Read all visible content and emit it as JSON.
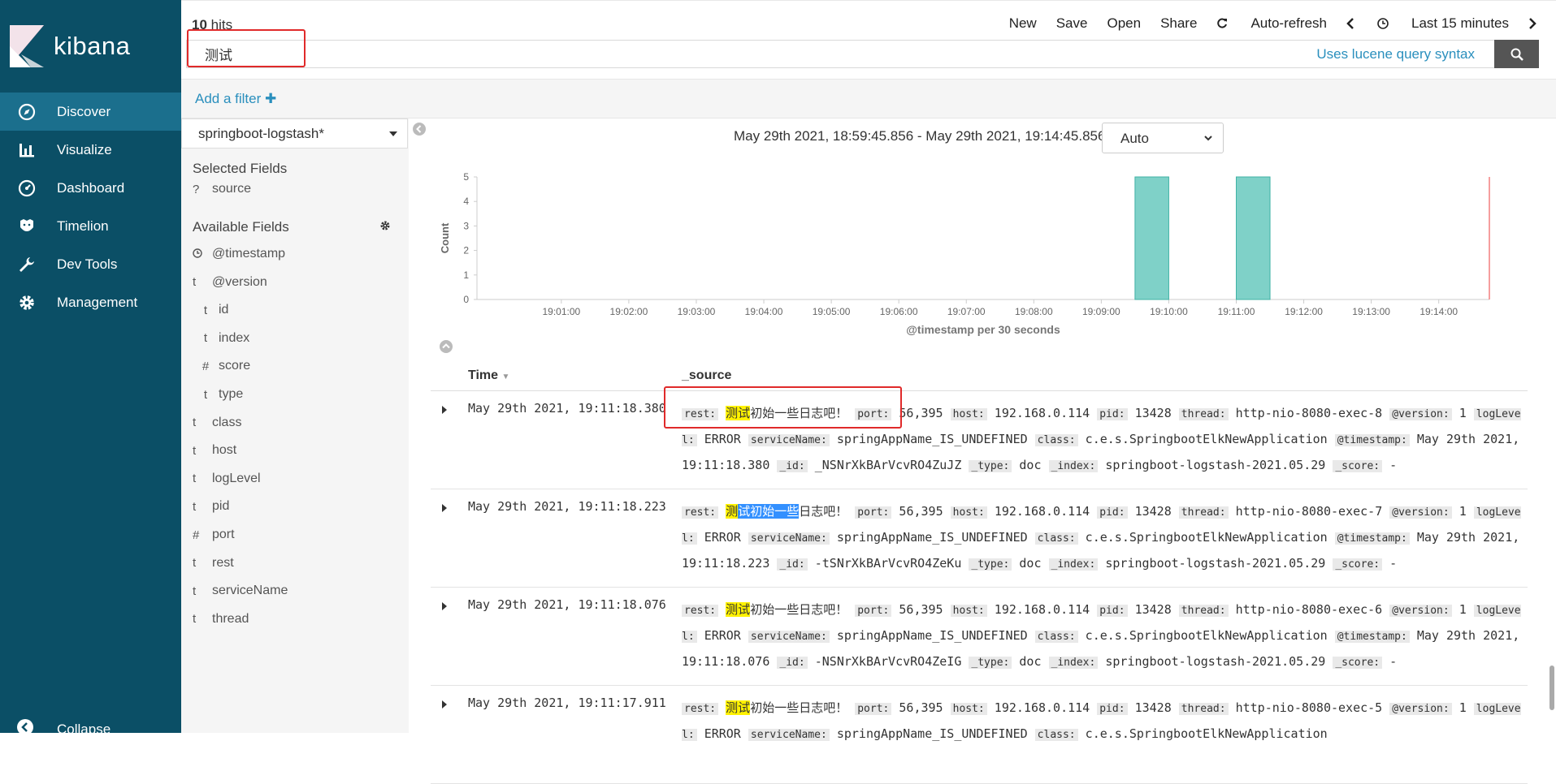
{
  "app": {
    "name": "kibana"
  },
  "nav": {
    "items": [
      {
        "label": "Discover",
        "icon": "compass-icon",
        "active": true
      },
      {
        "label": "Visualize",
        "icon": "bar-chart-icon",
        "active": false
      },
      {
        "label": "Dashboard",
        "icon": "dashboard-icon",
        "active": false
      },
      {
        "label": "Timelion",
        "icon": "timelion-icon",
        "active": false
      },
      {
        "label": "Dev Tools",
        "icon": "wrench-icon",
        "active": false
      },
      {
        "label": "Management",
        "icon": "gear-icon",
        "active": false
      }
    ],
    "collapse_label": "Collapse"
  },
  "header": {
    "hits_count": "10",
    "hits_label": " hits",
    "menu": {
      "new": "New",
      "save": "Save",
      "open": "Open",
      "share": "Share",
      "auto_refresh": "Auto-refresh",
      "time_label": "Last 15 minutes"
    }
  },
  "query": {
    "value": "测试",
    "syntax_link": "Uses lucene query syntax"
  },
  "filters": {
    "add_label": "Add a filter"
  },
  "sidebar": {
    "index_pattern": "springboot-logstash*",
    "selected_title": "Selected Fields",
    "selected_fields": [
      {
        "type": "?",
        "name": "source"
      }
    ],
    "available_title": "Available Fields",
    "available_fields": [
      {
        "type": "clock",
        "name": "@timestamp"
      },
      {
        "type": "t",
        "name": "@version"
      },
      {
        "type": "t",
        "name": "id"
      },
      {
        "type": "t",
        "name": "index"
      },
      {
        "type": "#",
        "name": "score"
      },
      {
        "type": "t",
        "name": "type"
      },
      {
        "type": "t",
        "name": "class"
      },
      {
        "type": "t",
        "name": "host"
      },
      {
        "type": "t",
        "name": "logLevel"
      },
      {
        "type": "t",
        "name": "pid"
      },
      {
        "type": "#",
        "name": "port"
      },
      {
        "type": "t",
        "name": "rest"
      },
      {
        "type": "t",
        "name": "serviceName"
      },
      {
        "type": "t",
        "name": "thread"
      }
    ]
  },
  "histogram": {
    "range_text": "May 29th 2021, 18:59:45.856 - May 29th 2021, 19:14:45.856 —",
    "interval": "Auto"
  },
  "chart_data": {
    "type": "bar",
    "xlabel": "@timestamp per 30 seconds",
    "ylabel": "Count",
    "ylim": [
      0,
      5
    ],
    "yticks": [
      0,
      1,
      2,
      3,
      4,
      5
    ],
    "xticks": [
      "19:01:00",
      "19:02:00",
      "19:03:00",
      "19:04:00",
      "19:05:00",
      "19:06:00",
      "19:07:00",
      "19:08:00",
      "19:09:00",
      "19:10:00",
      "19:11:00",
      "19:12:00",
      "19:13:00",
      "19:14:00"
    ],
    "x_start": "18:59:45",
    "x_end": "19:14:45",
    "bars": [
      {
        "start": "19:09:30",
        "end": "19:10:00",
        "value": 5
      },
      {
        "start": "19:11:00",
        "end": "19:11:30",
        "value": 5
      }
    ],
    "bar_color": "#7fd1c8",
    "grid": false
  },
  "table": {
    "col_time": "Time",
    "col_source": "_source",
    "rows": [
      {
        "time": "May 29th 2021, 19:11:18.380",
        "rest_hl": "测试",
        "rest_sel": "",
        "rest_rest": "初始一些日志吧！",
        "port": "56,395",
        "host": "192.168.0.114",
        "pid": "13428",
        "thread": "http-nio-8080-exec-8",
        "version": "1",
        "logLevel": "ERROR",
        "serviceName": "springAppName_IS_UNDEFINED",
        "class": "c.e.s.SpringbootElkNewApplication",
        "timestamp": "May 29th 2021, 19:11:18.380",
        "id": "_NSNrXkBArVcvRO4ZuJZ",
        "type": "doc",
        "index": "springboot-logstash-2021.05.29",
        "score": "-"
      },
      {
        "time": "May 29th 2021, 19:11:18.223",
        "rest_hl": "测",
        "rest_sel": "试初始一些",
        "rest_rest": "日志吧！",
        "port": "56,395",
        "host": "192.168.0.114",
        "pid": "13428",
        "thread": "http-nio-8080-exec-7",
        "version": "1",
        "logLevel": "ERROR",
        "serviceName": "springAppName_IS_UNDEFINED",
        "class": "c.e.s.SpringbootElkNewApplication",
        "timestamp": "May 29th 2021, 19:11:18.223",
        "id": "-tSNrXkBArVcvRO4ZeKu",
        "type": "doc",
        "index": "springboot-logstash-2021.05.29",
        "score": "-"
      },
      {
        "time": "May 29th 2021, 19:11:18.076",
        "rest_hl": "测试",
        "rest_sel": "",
        "rest_rest": "初始一些日志吧！",
        "port": "56,395",
        "host": "192.168.0.114",
        "pid": "13428",
        "thread": "http-nio-8080-exec-6",
        "version": "1",
        "logLevel": "ERROR",
        "serviceName": "springAppName_IS_UNDEFINED",
        "class": "c.e.s.SpringbootElkNewApplication",
        "timestamp": "May 29th 2021, 19:11:18.076",
        "id": "-NSNrXkBArVcvRO4ZeIG",
        "type": "doc",
        "index": "springboot-logstash-2021.05.29",
        "score": "-"
      },
      {
        "time": "May 29th 2021, 19:11:17.911",
        "rest_hl": "测试",
        "rest_sel": "",
        "rest_rest": "初始一些日志吧！",
        "port": "56,395",
        "host": "192.168.0.114",
        "pid": "13428",
        "thread": "http-nio-8080-exec-5",
        "version": "1",
        "logLevel": "ERROR",
        "serviceName": "springAppName_IS_UNDEFINED",
        "class": "c.e.s.SpringbootElkNewApplication",
        "timestamp": "",
        "id": "",
        "type": "",
        "index": "",
        "score": ""
      }
    ]
  }
}
